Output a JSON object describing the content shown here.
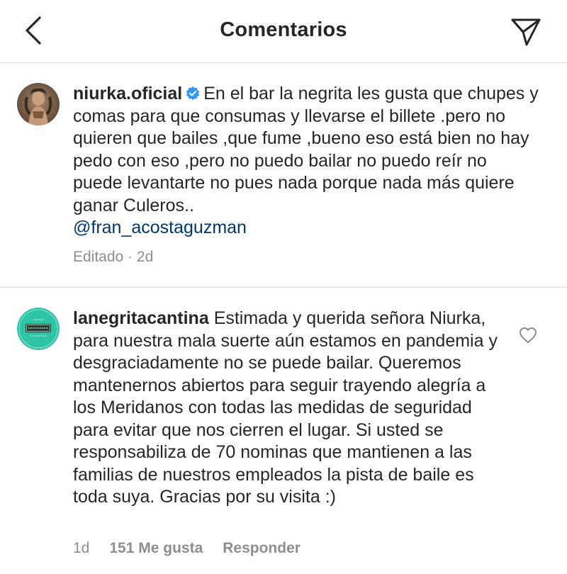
{
  "header": {
    "title": "Comentarios",
    "back_icon": "chevron-left-icon",
    "share_icon": "paper-plane-icon"
  },
  "caption": {
    "username": "niurka.oficial",
    "verified": true,
    "text": "En el bar la negrita les gusta que chupes y comas para que consumas y llevarse el billete .pero no quieren que bailes ,que fume ,bueno eso está bien no hay pedo con eso ,pero no puedo bailar no puedo reír no puede levantarte no pues nada porque nada más quiere ganar Culeros..",
    "mention": "@fran_acostaguzman",
    "meta": "Editado · 2d"
  },
  "reply": {
    "username": "lanegritacantina",
    "text": "Estimada y querida señora Niurka, para nuestra mala suerte aún estamos en pandemia y desgraciadamente no se puede bailar. Queremos mantenernos abiertos para seguir trayendo alegría a los Meridanos con todas las medidas de seguridad para evitar que nos cierren el lugar. Si usted se responsabiliza de 70 nominas que mantienen a las familias de nuestros empleados la pista de baile es toda suya. Gracias por su visita :)",
    "time": "1d",
    "likes": "151 Me gusta",
    "reply_label": "Responder",
    "like_icon": "heart-outline-icon"
  },
  "colors": {
    "text": "#262626",
    "secondary": "#8e8e8e",
    "mention": "#00376b",
    "verified": "#3897f0",
    "divider": "#dbdbdb",
    "cantina_avatar": "#2ec4a6"
  }
}
